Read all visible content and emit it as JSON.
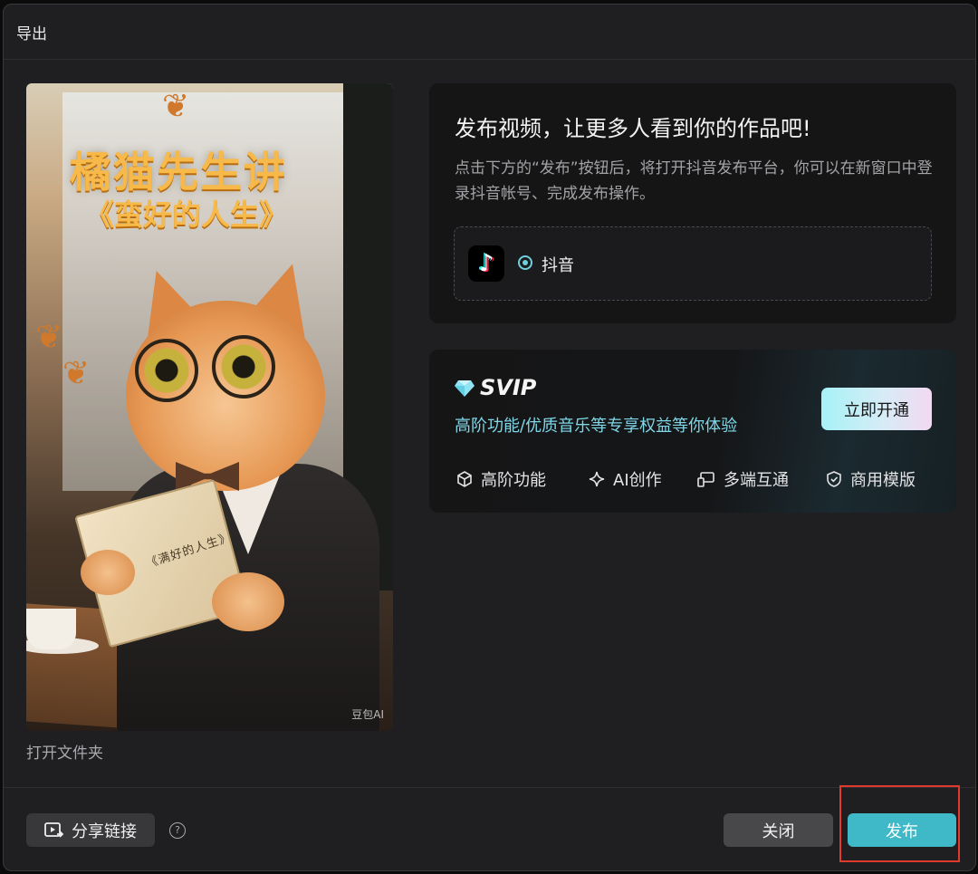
{
  "dialog": {
    "title": "导出"
  },
  "poster": {
    "headline": "橘猫先生讲",
    "subline": "《蛮好的人生》",
    "book_title": "《满好的人生》",
    "watermark": "豆包AI"
  },
  "open_folder": "打开文件夹",
  "publish": {
    "heading": "发布视频，让更多人看到你的作品吧!",
    "description": "点击下方的“发布”按钮后，将打开抖音发布平台，你可以在新窗口中登录抖音帐号、完成发布操作。",
    "platform": {
      "name": "抖音",
      "icon": "douyin-logo",
      "selected": true
    }
  },
  "svip": {
    "label": "SVIP",
    "description": "高阶功能/优质音乐等专享权益等你体验",
    "cta": "立即开通",
    "features": [
      {
        "label": "高阶功能",
        "icon": "cube-icon"
      },
      {
        "label": "AI创作",
        "icon": "sparkle-icon"
      },
      {
        "label": "多端互通",
        "icon": "devices-icon"
      },
      {
        "label": "商用模版",
        "icon": "shield-check-icon"
      }
    ]
  },
  "footer": {
    "share_label": "分享链接",
    "help_icon": "question-icon",
    "close_label": "关闭",
    "publish_label": "发布"
  },
  "colors": {
    "accent": "#3fb9c8",
    "svip_text": "#7fd7e8",
    "highlight_box": "#e03a2c"
  }
}
